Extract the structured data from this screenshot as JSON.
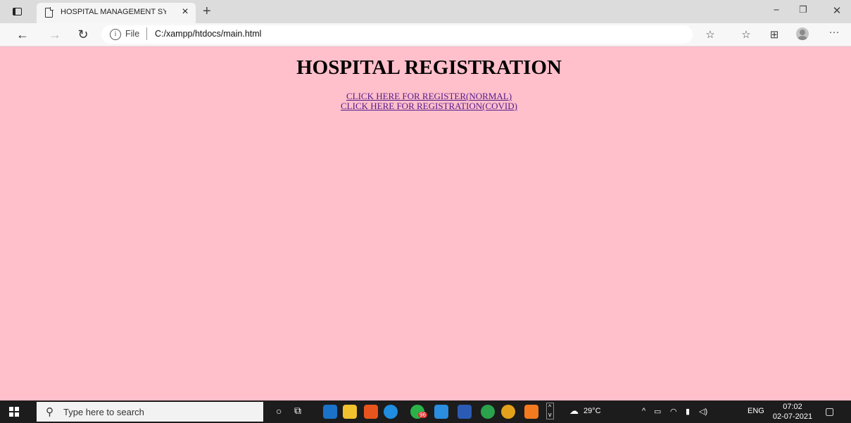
{
  "browser": {
    "tab_title": "HOSPITAL MANAGEMENT SYSTE",
    "tab_close": "×",
    "new_tab": "+",
    "address_scheme": "File",
    "address_url": "C:/xampp/htdocs/main.html",
    "more_menu": "···"
  },
  "page": {
    "heading": "HOSPITAL REGISTRATION",
    "links": [
      "CLICK HERE FOR REGISTER(NORMAL)",
      "CLICK HERE FOR REGISTRATION(COVID)"
    ],
    "background_color": "#ffbfcb",
    "link_color": "#551a8b"
  },
  "taskbar": {
    "search_placeholder": "Type here to search",
    "temperature": "29°C",
    "language": "ENG",
    "time": "07:02",
    "date": "02-07-2021",
    "badge": "96"
  }
}
